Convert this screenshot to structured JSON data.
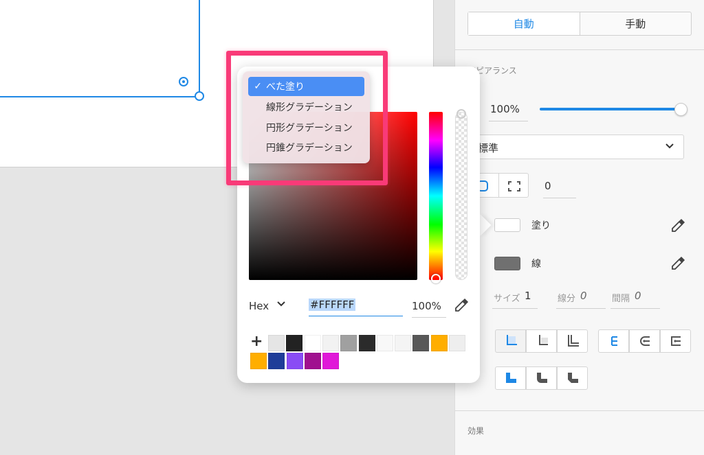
{
  "panel": {
    "mode_tabs": [
      "自動",
      "手動"
    ],
    "appearance_title": "アピアランス",
    "opacity_value": "100%",
    "opacity_fraction": 1.0,
    "blend_mode": "標準",
    "corner_radius": "0",
    "fill_label": "塗り",
    "stroke_label": "線",
    "stroke": {
      "size_label": "サイズ",
      "size_value": "1",
      "dash_label": "線分",
      "dash_value": "0",
      "gap_label": "間隔",
      "gap_value": "0"
    },
    "effects_title": "効果"
  },
  "picker": {
    "format_label": "Hex",
    "hex_value": "#FFFFFF",
    "opacity_value": "100%",
    "add_symbol": "+",
    "swatches_row1": [
      "#e5e5e5",
      "#222222",
      "#ffffff",
      "#f2f2f2",
      "#a0a0a0",
      "#2b2b2b",
      "#f8f8f8",
      "#f4f4f4",
      "#585858",
      "#ffae00",
      "#eeeeee"
    ],
    "swatches_row2": [
      "#ffae00",
      "#1f3d99",
      "#8a4cf5",
      "#a0108f",
      "#e018d8"
    ]
  },
  "fill_type_menu": {
    "items": [
      {
        "label": "べた塗り",
        "selected": true
      },
      {
        "label": "線形グラデーション",
        "selected": false
      },
      {
        "label": "円形グラデーション",
        "selected": false
      },
      {
        "label": "円錐グラデーション",
        "selected": false
      }
    ]
  },
  "colors": {
    "accent": "#1e88e5",
    "highlight": "#f93a78",
    "menu_selected": "#4a8ef4"
  },
  "icons": [
    "eyedropper-icon",
    "chevron-down-icon",
    "checkmark-icon",
    "plus-icon"
  ]
}
